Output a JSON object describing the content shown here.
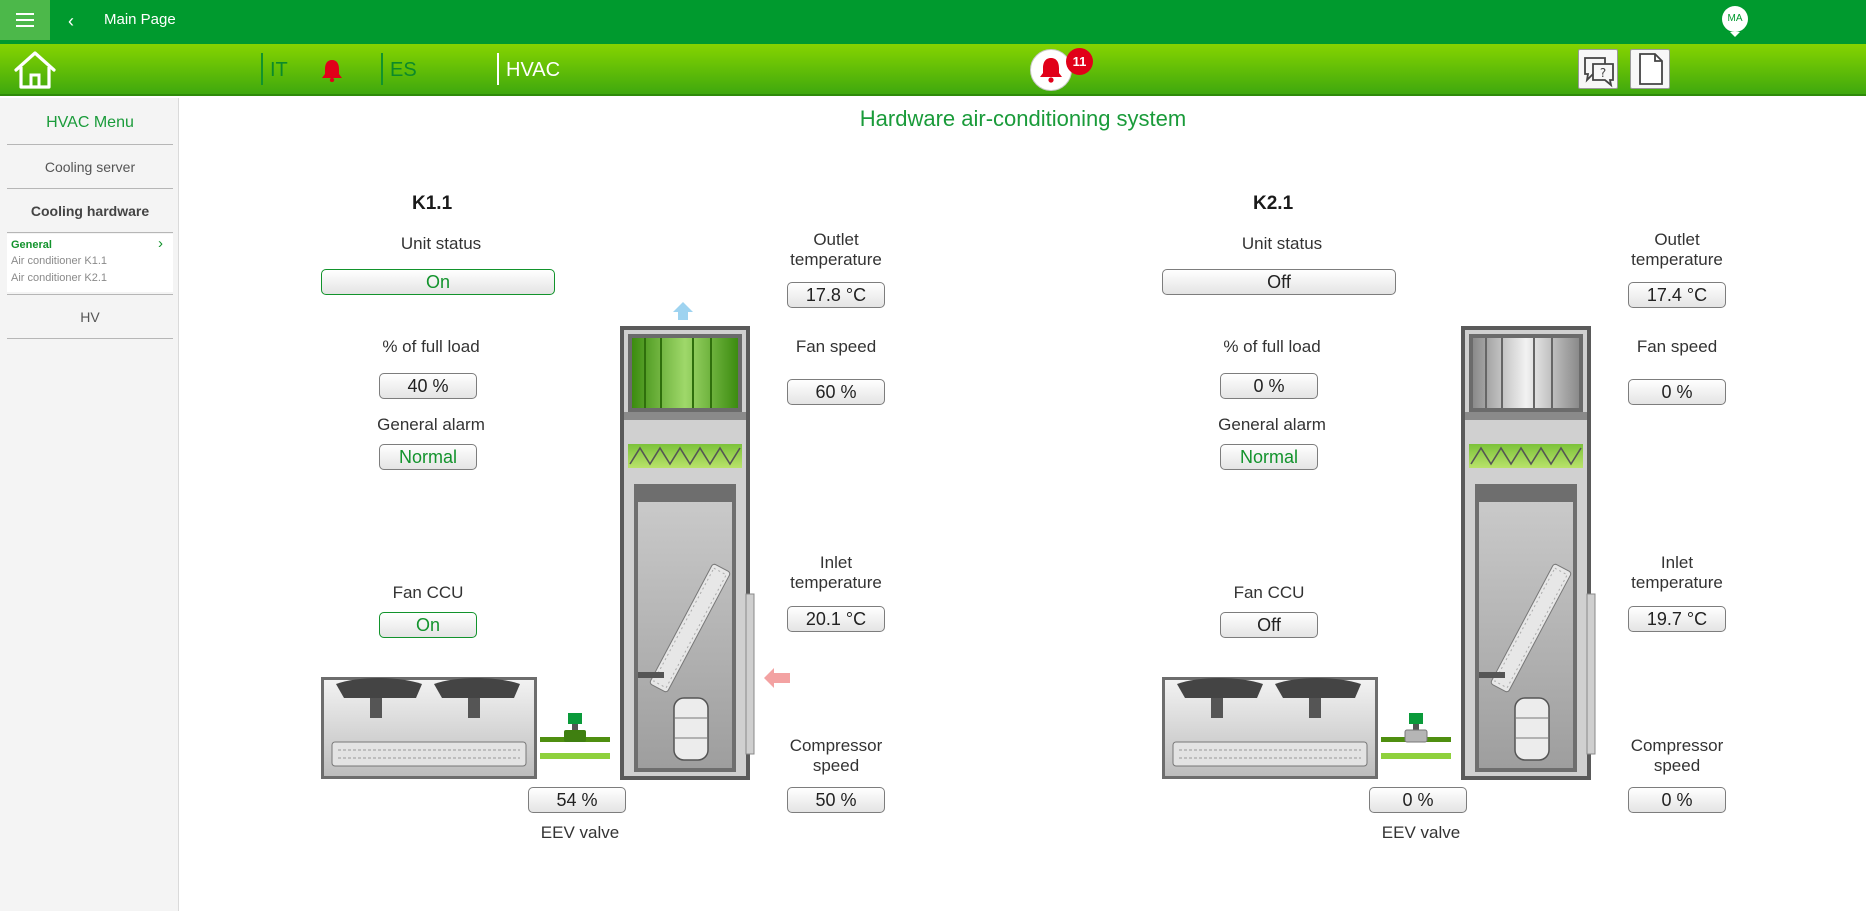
{
  "topbar": {
    "menu_icon": "hamburger-menu-icon",
    "back_icon": "chevron-left-icon",
    "title": "Main Page",
    "avatar_initials": "MA"
  },
  "navbar": {
    "home_icon": "home-icon",
    "item_it": "IT",
    "bell_icon": "bell-icon",
    "item_es": "ES",
    "item_hvac": "HVAC",
    "alarm_count": "11",
    "help_icon": "help-chat-icon",
    "document_icon": "document-icon"
  },
  "sidebar": {
    "title": "HVAC Menu",
    "items": [
      "Cooling server",
      "Cooling hardware",
      "HV"
    ],
    "sub_active": "General",
    "sub_items": [
      "Air conditioner K1.1",
      "Air conditioner K2.1"
    ]
  },
  "page": {
    "title": "Hardware air-conditioning system"
  },
  "units": [
    {
      "name": "K1.1",
      "unit_status_label": "Unit status",
      "unit_status": "On",
      "load_label": "% of full load",
      "load": "40 %",
      "alarm_label": "General alarm",
      "alarm": "Normal",
      "fan_ccu_label": "Fan CCU",
      "fan_ccu": "On",
      "eev_label": "EEV valve",
      "eev": "54 %",
      "outlet_label_1": "Outlet",
      "outlet_label_2": "temperature",
      "outlet": "17.8 °C",
      "fan_speed_label": "Fan speed",
      "fan_speed": "60 %",
      "inlet_label_1": "Inlet",
      "inlet_label_2": "temperature",
      "inlet": "20.1 °C",
      "compressor_label_1": "Compressor",
      "compressor_label_2": "speed",
      "compressor": "50 %",
      "fan_active": true
    },
    {
      "name": "K2.1",
      "unit_status_label": "Unit status",
      "unit_status": "Off",
      "load_label": "% of full load",
      "load": "0 %",
      "alarm_label": "General alarm",
      "alarm": "Normal",
      "fan_ccu_label": "Fan CCU",
      "fan_ccu": "Off",
      "eev_label": "EEV valve",
      "eev": "0 %",
      "outlet_label_1": "Outlet",
      "outlet_label_2": "temperature",
      "outlet": "17.4 °C",
      "fan_speed_label": "Fan speed",
      "fan_speed": "0 %",
      "inlet_label_1": "Inlet",
      "inlet_label_2": "temperature",
      "inlet": "19.7 °C",
      "compressor_label_1": "Compressor",
      "compressor_label_2": "speed",
      "compressor": "0 %",
      "fan_active": false
    }
  ],
  "colors": {
    "top_green": "#009a2e",
    "nav_green_light": "#86d400",
    "accent_green": "#1a9b3a",
    "alarm_red": "#e10019"
  }
}
